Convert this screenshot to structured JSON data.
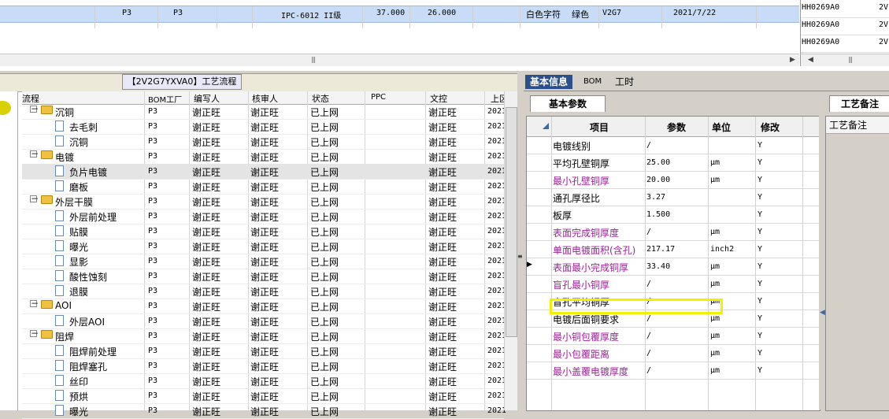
{
  "top_grid": {
    "row": {
      "bom_factory": "P3",
      "factory": "P3",
      "standard": "IPC-6012 II级",
      "val1": "37.000",
      "val2": "26.000",
      "char_color": "白色字符",
      "color": "绿色",
      "code": "V2G7",
      "date": "2021/7/22"
    },
    "right_codes": [
      "HH0269A0",
      "HH0269A0",
      "HH0269A0"
    ],
    "right_suffix": [
      "2V",
      "2V",
      "2V"
    ]
  },
  "process_panel": {
    "title": "【2V2G7YXVA0】工艺流程",
    "columns": [
      "流程",
      "BOM工厂",
      "编写人",
      "核审人",
      "状态",
      "PPC",
      "文控",
      "上区"
    ],
    "rows": [
      {
        "name": "沉铜",
        "type": "folder",
        "level": 1,
        "bom": "P3",
        "writer": "谢正旺",
        "reviewer": "谢正旺",
        "status": "已上网",
        "ppc": "",
        "doc": "谢正旺",
        "date": "2021"
      },
      {
        "name": "去毛刺",
        "type": "doc",
        "level": 2,
        "bom": "P3",
        "writer": "谢正旺",
        "reviewer": "谢正旺",
        "status": "已上网",
        "ppc": "",
        "doc": "谢正旺",
        "date": "2021"
      },
      {
        "name": "沉铜",
        "type": "doc",
        "level": 2,
        "bom": "P3",
        "writer": "谢正旺",
        "reviewer": "谢正旺",
        "status": "已上网",
        "ppc": "",
        "doc": "谢正旺",
        "date": "2021"
      },
      {
        "name": "电镀",
        "type": "folder",
        "level": 1,
        "bom": "P3",
        "writer": "谢正旺",
        "reviewer": "谢正旺",
        "status": "已上网",
        "ppc": "",
        "doc": "谢正旺",
        "date": "2021"
      },
      {
        "name": "负片电镀",
        "type": "doc",
        "level": 2,
        "bom": "P3",
        "writer": "谢正旺",
        "reviewer": "谢正旺",
        "status": "已上网",
        "ppc": "",
        "doc": "谢正旺",
        "date": "2021",
        "selected": true
      },
      {
        "name": "磨板",
        "type": "doc",
        "level": 2,
        "bom": "P3",
        "writer": "谢正旺",
        "reviewer": "谢正旺",
        "status": "已上网",
        "ppc": "",
        "doc": "谢正旺",
        "date": "2021"
      },
      {
        "name": "外层干膜",
        "type": "folder",
        "level": 1,
        "bom": "P3",
        "writer": "谢正旺",
        "reviewer": "谢正旺",
        "status": "已上网",
        "ppc": "",
        "doc": "谢正旺",
        "date": "2021"
      },
      {
        "name": "外层前处理",
        "type": "doc",
        "level": 2,
        "bom": "P3",
        "writer": "谢正旺",
        "reviewer": "谢正旺",
        "status": "已上网",
        "ppc": "",
        "doc": "谢正旺",
        "date": "2021"
      },
      {
        "name": "贴膜",
        "type": "doc",
        "level": 2,
        "bom": "P3",
        "writer": "谢正旺",
        "reviewer": "谢正旺",
        "status": "已上网",
        "ppc": "",
        "doc": "谢正旺",
        "date": "2021"
      },
      {
        "name": "曝光",
        "type": "doc",
        "level": 2,
        "bom": "P3",
        "writer": "谢正旺",
        "reviewer": "谢正旺",
        "status": "已上网",
        "ppc": "",
        "doc": "谢正旺",
        "date": "2021"
      },
      {
        "name": "显影",
        "type": "doc",
        "level": 2,
        "bom": "P3",
        "writer": "谢正旺",
        "reviewer": "谢正旺",
        "status": "已上网",
        "ppc": "",
        "doc": "谢正旺",
        "date": "2021"
      },
      {
        "name": "酸性蚀刻",
        "type": "doc",
        "level": 2,
        "bom": "P3",
        "writer": "谢正旺",
        "reviewer": "谢正旺",
        "status": "已上网",
        "ppc": "",
        "doc": "谢正旺",
        "date": "2021"
      },
      {
        "name": "退膜",
        "type": "doc",
        "level": 2,
        "bom": "P3",
        "writer": "谢正旺",
        "reviewer": "谢正旺",
        "status": "已上网",
        "ppc": "",
        "doc": "谢正旺",
        "date": "2021"
      },
      {
        "name": "AOI",
        "type": "folder",
        "level": 1,
        "bom": "P3",
        "writer": "谢正旺",
        "reviewer": "谢正旺",
        "status": "已上网",
        "ppc": "",
        "doc": "谢正旺",
        "date": "2021"
      },
      {
        "name": "外层AOI",
        "type": "doc",
        "level": 2,
        "bom": "P3",
        "writer": "谢正旺",
        "reviewer": "谢正旺",
        "status": "已上网",
        "ppc": "",
        "doc": "谢正旺",
        "date": "2021"
      },
      {
        "name": "阻焊",
        "type": "folder",
        "level": 1,
        "bom": "P3",
        "writer": "谢正旺",
        "reviewer": "谢正旺",
        "status": "已上网",
        "ppc": "",
        "doc": "谢正旺",
        "date": "2021"
      },
      {
        "name": "阻焊前处理",
        "type": "doc",
        "level": 2,
        "bom": "P3",
        "writer": "谢正旺",
        "reviewer": "谢正旺",
        "status": "已上网",
        "ppc": "",
        "doc": "谢正旺",
        "date": "2021"
      },
      {
        "name": "阻焊塞孔",
        "type": "doc",
        "level": 2,
        "bom": "P3",
        "writer": "谢正旺",
        "reviewer": "谢正旺",
        "status": "已上网",
        "ppc": "",
        "doc": "谢正旺",
        "date": "2021"
      },
      {
        "name": "丝印",
        "type": "doc",
        "level": 2,
        "bom": "P3",
        "writer": "谢正旺",
        "reviewer": "谢正旺",
        "status": "已上网",
        "ppc": "",
        "doc": "谢正旺",
        "date": "2021"
      },
      {
        "name": "预烘",
        "type": "doc",
        "level": 2,
        "bom": "P3",
        "writer": "谢正旺",
        "reviewer": "谢正旺",
        "status": "已上网",
        "ppc": "",
        "doc": "谢正旺",
        "date": "2021"
      },
      {
        "name": "曝光",
        "type": "doc",
        "level": 2,
        "bom": "P3",
        "writer": "谢正旺",
        "reviewer": "谢正旺",
        "status": "已上网",
        "ppc": "",
        "doc": "谢正旺",
        "date": "2021"
      }
    ]
  },
  "right_panel": {
    "tabs": [
      "基本信息",
      "BOM",
      "工时"
    ],
    "subtab": "基本参数",
    "remark_tab": "工艺备注",
    "remark_header": "工艺备注",
    "columns": [
      "项目",
      "参数",
      "单位",
      "修改"
    ],
    "params": [
      {
        "item": "电镀线别",
        "value": "/",
        "unit": "",
        "mod": "Y",
        "purple": false
      },
      {
        "item": "平均孔壁铜厚",
        "value": "25.00",
        "unit": "μm",
        "mod": "Y",
        "purple": false
      },
      {
        "item": "最小孔壁铜厚",
        "value": "20.00",
        "unit": "μm",
        "mod": "Y",
        "purple": true
      },
      {
        "item": "通孔厚径比",
        "value": "3.27",
        "unit": "",
        "mod": "Y",
        "purple": false
      },
      {
        "item": "板厚",
        "value": "1.500",
        "unit": "",
        "mod": "Y",
        "purple": false
      },
      {
        "item": "表面完成铜厚度",
        "value": "/",
        "unit": "μm",
        "mod": "Y",
        "purple": true
      },
      {
        "item": "单面电镀面积(含孔)",
        "value": "217.17",
        "unit": "inch2",
        "mod": "Y",
        "purple": true
      },
      {
        "item": "表面最小完成铜厚",
        "value": "33.40",
        "unit": "μm",
        "mod": "Y",
        "purple": true,
        "current": true
      },
      {
        "item": "盲孔最小铜厚",
        "value": "/",
        "unit": "μm",
        "mod": "Y",
        "purple": true
      },
      {
        "item": "盲孔平均铜厚",
        "value": "/",
        "unit": "μm",
        "mod": "Y",
        "purple": false
      },
      {
        "item": "电镀后面铜要求",
        "value": "/",
        "unit": "μm",
        "mod": "Y",
        "purple": false
      },
      {
        "item": "最小铜包覆厚度",
        "value": "/",
        "unit": "μm",
        "mod": "Y",
        "purple": true
      },
      {
        "item": "最小包覆距离",
        "value": "/",
        "unit": "μm",
        "mod": "Y",
        "purple": true
      },
      {
        "item": "最小盖覆电镀厚度",
        "value": "/",
        "unit": "μm",
        "mod": "Y",
        "purple": true
      }
    ]
  },
  "colors": {
    "purple_text": "#a0209a",
    "tab_active": "#2a4f8a",
    "highlight": "#f0f000",
    "selected_row": "#c9dcf7"
  }
}
